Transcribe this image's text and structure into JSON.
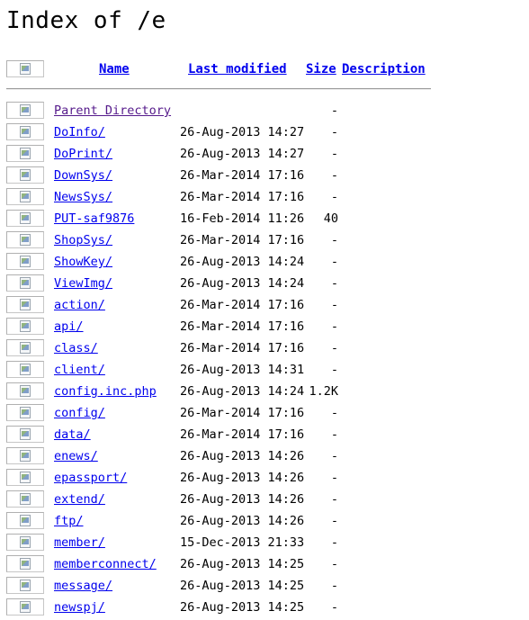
{
  "page_title": "Index of /e",
  "columns": {
    "name": "Name",
    "last_modified": "Last modified",
    "size": "Size",
    "description": "Description"
  },
  "colors": {
    "link": "#0000ee",
    "visited_link": "#551a8b",
    "rule": "#9a9a9a"
  },
  "icons": {
    "header": "blank-icon",
    "parent": "back-icon",
    "folder": "folder-icon",
    "file": "file-icon"
  },
  "entries": [
    {
      "name": "Parent Directory",
      "modified": "",
      "size": "-",
      "icon": "back-icon",
      "visited": true
    },
    {
      "name": "DoInfo/",
      "modified": "26-Aug-2013 14:27",
      "size": "-",
      "icon": "folder-icon"
    },
    {
      "name": "DoPrint/",
      "modified": "26-Aug-2013 14:27",
      "size": "-",
      "icon": "folder-icon"
    },
    {
      "name": "DownSys/",
      "modified": "26-Mar-2014 17:16",
      "size": "-",
      "icon": "folder-icon"
    },
    {
      "name": "NewsSys/",
      "modified": "26-Mar-2014 17:16",
      "size": "-",
      "icon": "folder-icon"
    },
    {
      "name": "PUT-saf9876",
      "modified": "16-Feb-2014 11:26",
      "size": "40",
      "icon": "file-icon"
    },
    {
      "name": "ShopSys/",
      "modified": "26-Mar-2014 17:16",
      "size": "-",
      "icon": "folder-icon"
    },
    {
      "name": "ShowKey/",
      "modified": "26-Aug-2013 14:24",
      "size": "-",
      "icon": "folder-icon"
    },
    {
      "name": "ViewImg/",
      "modified": "26-Aug-2013 14:24",
      "size": "-",
      "icon": "folder-icon"
    },
    {
      "name": "action/",
      "modified": "26-Mar-2014 17:16",
      "size": "-",
      "icon": "folder-icon"
    },
    {
      "name": "api/",
      "modified": "26-Mar-2014 17:16",
      "size": "-",
      "icon": "folder-icon"
    },
    {
      "name": "class/",
      "modified": "26-Mar-2014 17:16",
      "size": "-",
      "icon": "folder-icon"
    },
    {
      "name": "client/",
      "modified": "26-Aug-2013 14:31",
      "size": "-",
      "icon": "folder-icon"
    },
    {
      "name": "config.inc.php",
      "modified": "26-Aug-2013 14:24",
      "size": "1.2K",
      "icon": "file-icon"
    },
    {
      "name": "config/",
      "modified": "26-Mar-2014 17:16",
      "size": "-",
      "icon": "folder-icon"
    },
    {
      "name": "data/",
      "modified": "26-Mar-2014 17:16",
      "size": "-",
      "icon": "folder-icon"
    },
    {
      "name": "enews/",
      "modified": "26-Aug-2013 14:26",
      "size": "-",
      "icon": "folder-icon"
    },
    {
      "name": "epassport/",
      "modified": "26-Aug-2013 14:26",
      "size": "-",
      "icon": "folder-icon"
    },
    {
      "name": "extend/",
      "modified": "26-Aug-2013 14:26",
      "size": "-",
      "icon": "folder-icon"
    },
    {
      "name": "ftp/",
      "modified": "26-Aug-2013 14:26",
      "size": "-",
      "icon": "folder-icon"
    },
    {
      "name": "member/",
      "modified": "15-Dec-2013 21:33",
      "size": "-",
      "icon": "folder-icon"
    },
    {
      "name": "memberconnect/",
      "modified": "26-Aug-2013 14:25",
      "size": "-",
      "icon": "folder-icon"
    },
    {
      "name": "message/",
      "modified": "26-Aug-2013 14:25",
      "size": "-",
      "icon": "folder-icon"
    },
    {
      "name": "newspj/",
      "modified": "26-Aug-2013 14:25",
      "size": "-",
      "icon": "folder-icon"
    }
  ]
}
